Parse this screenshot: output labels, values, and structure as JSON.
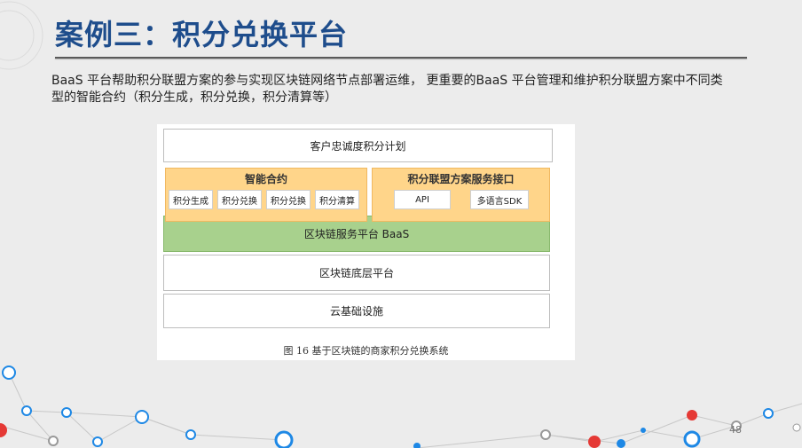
{
  "slide": {
    "title": "案例三：积分兑换平台",
    "description": "BaaS 平台帮助积分联盟方案的参与实现区块链网络节点部署运维， 更重要的BaaS 平台管理和维护积分联盟方案中不同类型的智能合约（积分生成，积分兑换，积分清算等）",
    "page_number": "48"
  },
  "diagram": {
    "top_layer": "客户忠诚度积分计划",
    "smart_contracts": {
      "title": "智能合约",
      "items": [
        "积分生成",
        "积分兑换",
        "积分兑换",
        "积分清算"
      ]
    },
    "service_interface": {
      "title": "积分联盟方案服务接口",
      "items": [
        "API",
        "多语言SDK"
      ]
    },
    "baas_layer": "区块链服务平台 BaaS",
    "base_layer": "区块链底层平台",
    "infra_layer": "云基础设施",
    "caption": "图 16  基于区块链的商家积分兑换系统"
  },
  "colors": {
    "title": "#1e4d8c",
    "orange": "#ffd58a",
    "green": "#a8d18d",
    "network_red": "#e53935",
    "network_blue": "#1e88e5"
  }
}
